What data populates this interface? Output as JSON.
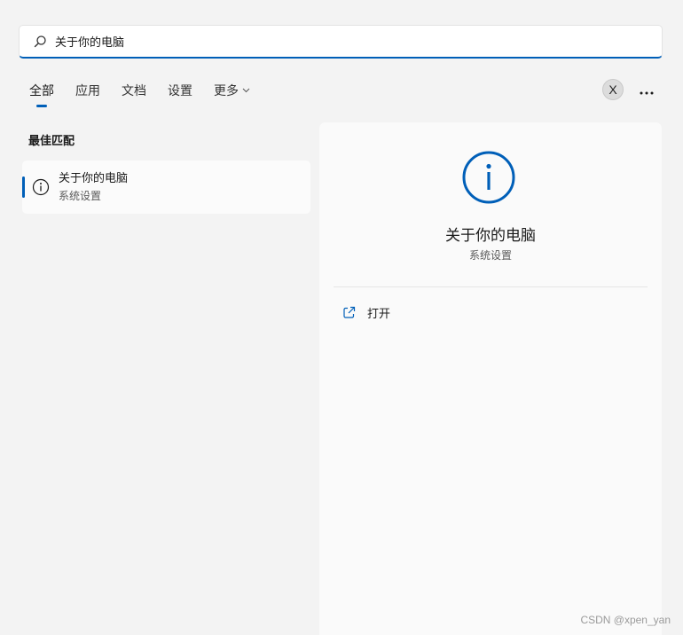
{
  "search": {
    "value": "关于你的电脑",
    "icon": "search-icon"
  },
  "tabs": [
    {
      "label": "全部",
      "active": true
    },
    {
      "label": "应用"
    },
    {
      "label": "文档"
    },
    {
      "label": "设置"
    },
    {
      "label": "更多"
    }
  ],
  "header": {
    "user_initial": "X",
    "more_icon": "ellipsis-icon"
  },
  "best_match": {
    "heading": "最佳匹配",
    "item": {
      "title": "关于你的电脑",
      "subtitle": "系统设置",
      "icon": "info-icon"
    }
  },
  "detail": {
    "title": "关于你的电脑",
    "subtitle": "系统设置",
    "icon": "info-icon",
    "actions": [
      {
        "label": "打开",
        "icon": "open-external-icon"
      }
    ]
  },
  "watermark": "CSDN @xpen_yan",
  "colors": {
    "accent": "#005fb8",
    "background": "#f3f3f3",
    "pane": "#fafafa"
  }
}
